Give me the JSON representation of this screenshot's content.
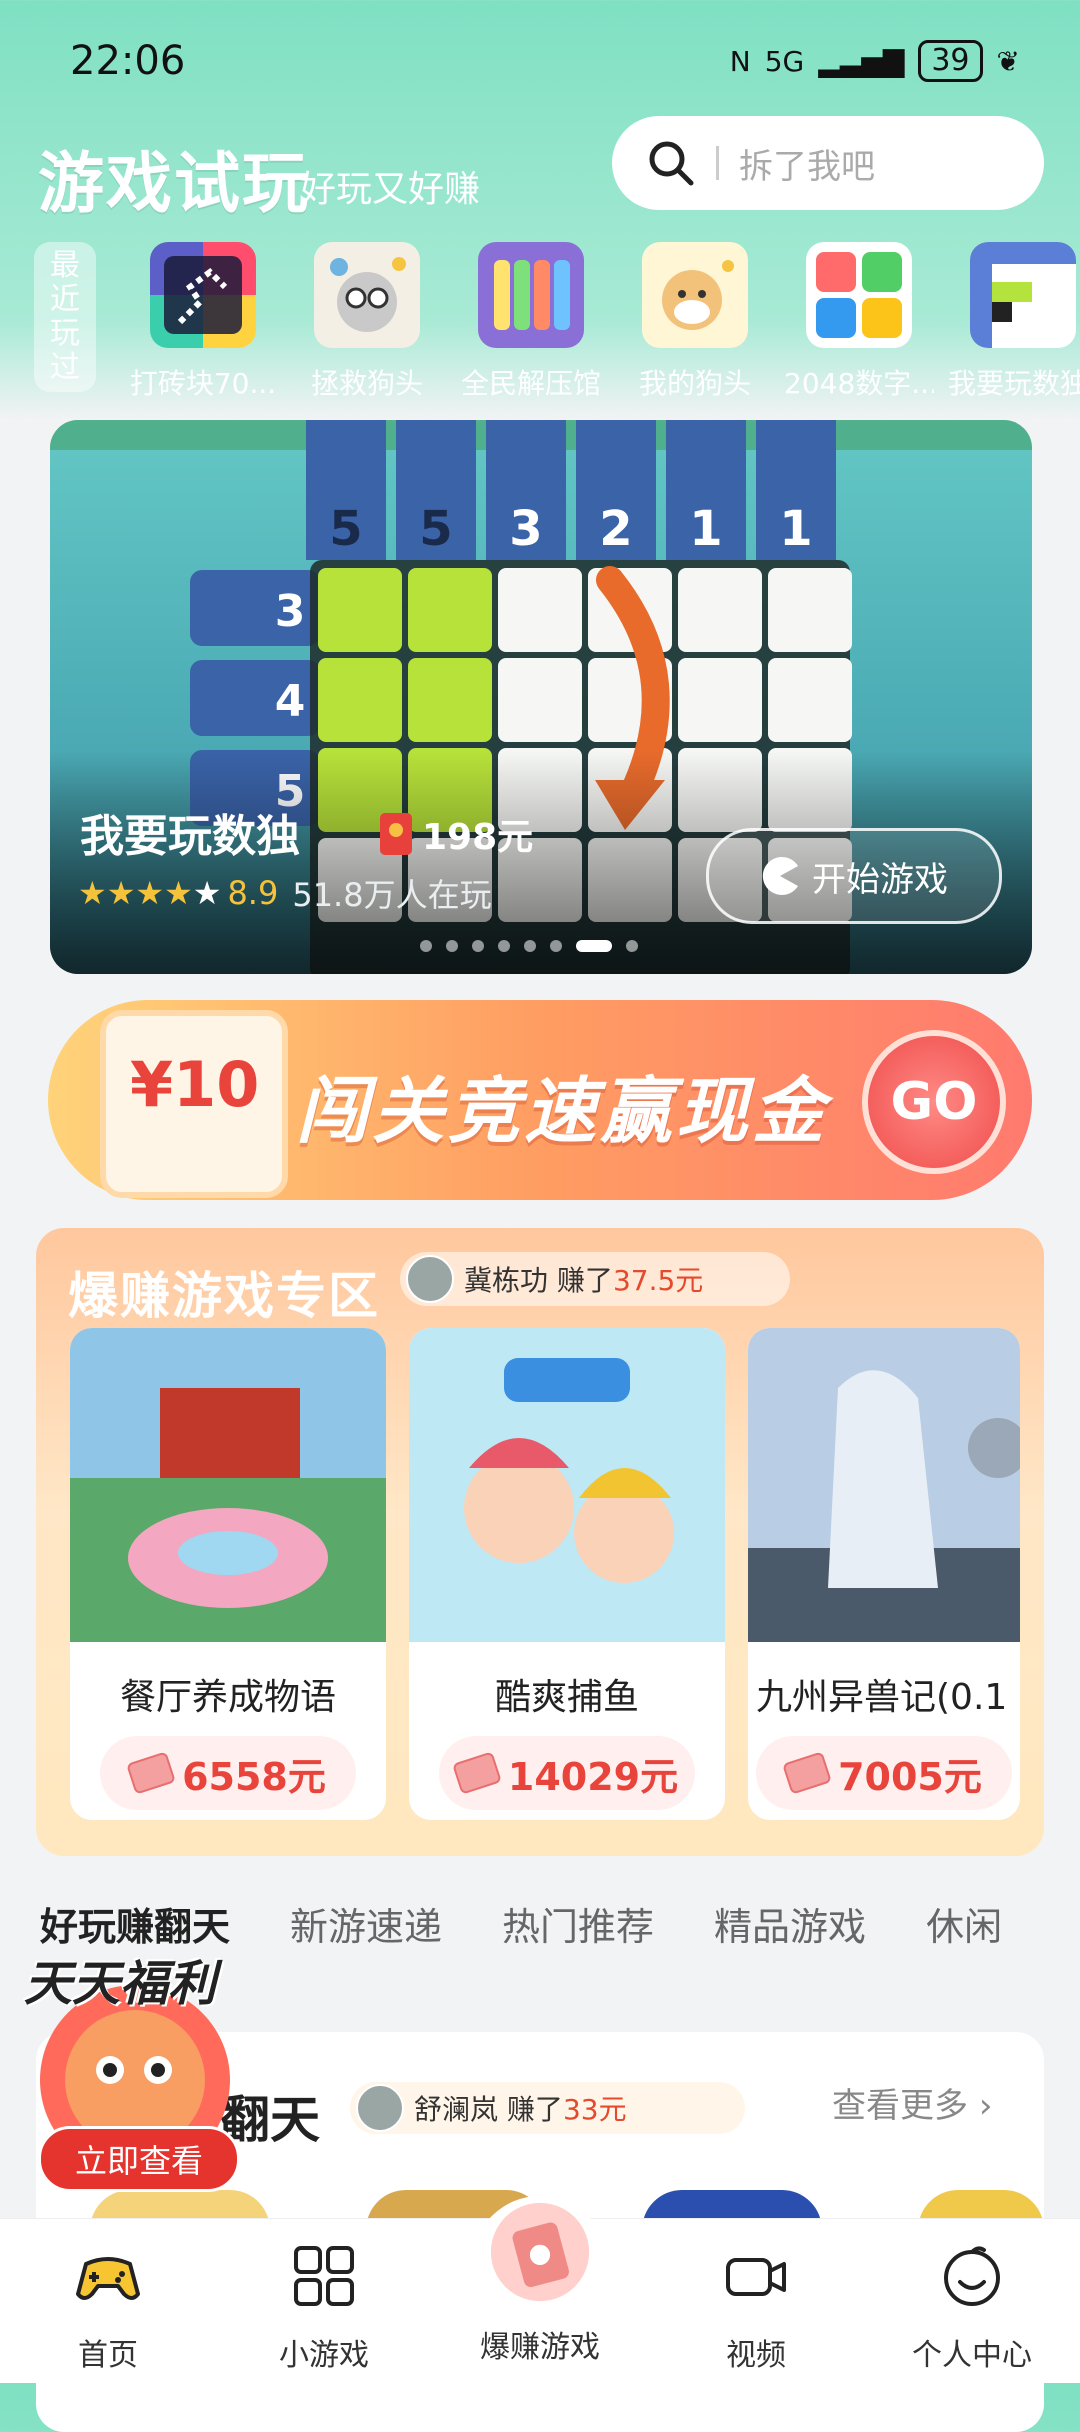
{
  "status": {
    "time": "22:06",
    "battery": "39",
    "network": "5G"
  },
  "header": {
    "title": "游戏试玩",
    "subtitle": "好玩又好赚",
    "search_placeholder": "拆了我吧"
  },
  "recent": {
    "label_chars": [
      "最",
      "近",
      "玩",
      "过"
    ],
    "items": [
      {
        "name": "打砖块70..."
      },
      {
        "name": "拯救狗头"
      },
      {
        "name": "全民解压馆"
      },
      {
        "name": "我的狗头"
      },
      {
        "name": "2048数字..."
      },
      {
        "name": "我要玩数独"
      }
    ]
  },
  "hero": {
    "col_clues": [
      "5",
      "5",
      "3",
      "2",
      "1",
      "1"
    ],
    "row_clues": [
      "3",
      "4",
      "5"
    ],
    "title": "我要玩数独",
    "reward": "198元",
    "rating": "8.9",
    "players": "51.8万人在玩",
    "play_label": "开始游戏",
    "slide_count": 8,
    "active_slide": 6
  },
  "promo": {
    "amount": "¥10",
    "text": "闯关竞速赢现金",
    "go": "GO"
  },
  "zone": {
    "title": "爆赚游戏专区",
    "ticker": {
      "user": "冀栋功",
      "text": "赚了",
      "amount": "37.5元"
    },
    "games": [
      {
        "name": "餐厅养成物语",
        "reward": "6558元"
      },
      {
        "name": "酷爽捕鱼",
        "reward": "14029元"
      },
      {
        "name": "九州异兽记(0.1",
        "reward": "7005元"
      }
    ]
  },
  "tabs": [
    "好玩赚翻天",
    "新游速递",
    "热门推荐",
    "精品游戏",
    "休闲"
  ],
  "section": {
    "title": "翻天",
    "ticker": {
      "user": "舒澜岚",
      "text": "赚了",
      "amount": "33元"
    },
    "more": "查看更多"
  },
  "floating": {
    "title": "天天福利",
    "button": "立即查看"
  },
  "nav": [
    {
      "label": "首页"
    },
    {
      "label": "小游戏"
    },
    {
      "label": "爆赚游戏"
    },
    {
      "label": "视频"
    },
    {
      "label": "个人中心"
    }
  ]
}
